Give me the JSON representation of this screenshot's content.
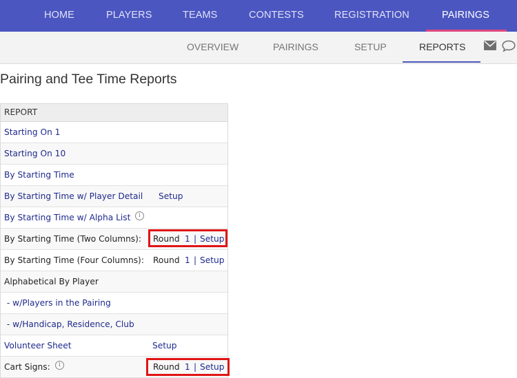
{
  "top_nav": {
    "items": [
      "HOME",
      "PLAYERS",
      "TEAMS",
      "CONTESTS",
      "REGISTRATION",
      "PAIRINGS"
    ],
    "active": "PAIRINGS"
  },
  "sub_nav": {
    "items": [
      "OVERVIEW",
      "PAIRINGS",
      "SETUP",
      "REPORTS"
    ],
    "active": "REPORTS",
    "icons": [
      "mail-icon",
      "chat-icon"
    ]
  },
  "page_title": "Pairing and Tee Time Reports",
  "table": {
    "header": "REPORT",
    "rows": [
      {
        "label": "Starting On 1"
      },
      {
        "label": "Starting On 10"
      },
      {
        "label": "By Starting Time"
      },
      {
        "label": "By Starting Time w/ Player Detail",
        "setup": "Setup"
      },
      {
        "label": "By Starting Time w/ Alpha List",
        "info": "i"
      },
      {
        "label": "By Starting Time (Two Columns):",
        "round_label": "Round",
        "round": "1",
        "sep": "|",
        "setup": "Setup"
      },
      {
        "label": "By Starting Time (Four Columns):",
        "round_label": "Round",
        "round": "1",
        "sep": "|",
        "setup": "Setup"
      },
      {
        "label": "Alphabetical By Player"
      },
      {
        "label": " - w/Players in the Pairing"
      },
      {
        "label": " - w/Handicap, Residence, Club"
      },
      {
        "label": "Volunteer Sheet",
        "setup": "Setup"
      },
      {
        "label": "Cart Signs:",
        "info": "i",
        "round_label": "Round",
        "round": "1",
        "sep": "|",
        "setup": "Setup"
      }
    ]
  },
  "colors": {
    "nav_bg": "#4b56c0",
    "nav_active_underline": "#e0487c",
    "link": "#1e2a8c",
    "highlight_box": "#e01414"
  }
}
